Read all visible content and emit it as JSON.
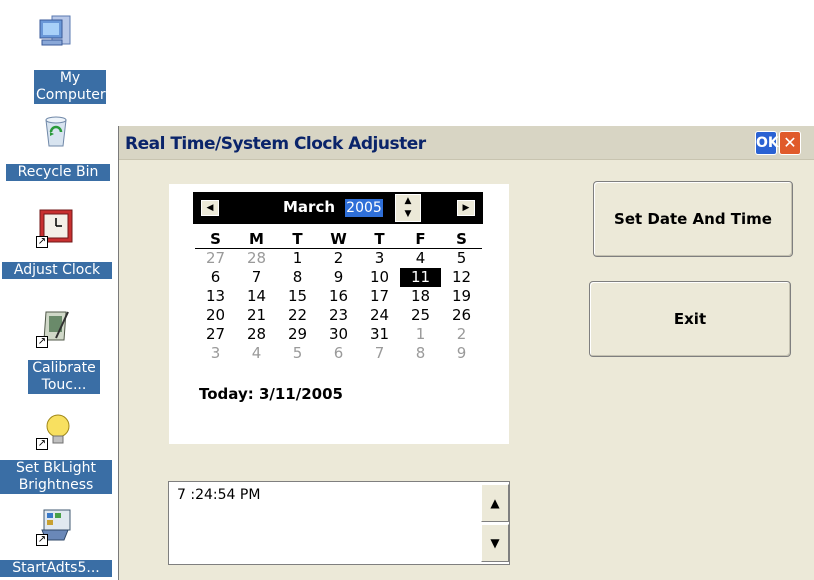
{
  "desktop": {
    "icons": [
      {
        "label1": "My",
        "label2": "Computer",
        "icon": "computer-icon"
      },
      {
        "label1": "Recycle Bin",
        "icon": "recycle-bin-icon"
      },
      {
        "label1": "Adjust Clock",
        "icon": "clock-icon"
      },
      {
        "label1": "Calibrate",
        "label2": "Touc...",
        "icon": "stylus-icon"
      },
      {
        "label1": "Set BkLight",
        "label2": "Brightness",
        "icon": "lightbulb-icon"
      },
      {
        "label1": "StartAdts5...",
        "icon": "program-icon"
      }
    ]
  },
  "window": {
    "title": "Real Time/System Clock Adjuster",
    "ok_label": "OK",
    "close_label": "✕"
  },
  "calendar": {
    "month": "March",
    "year": "2005",
    "weekdays": [
      "S",
      "M",
      "T",
      "W",
      "T",
      "F",
      "S"
    ],
    "weeks": [
      [
        "27",
        "28",
        "1",
        "2",
        "3",
        "4",
        "5"
      ],
      [
        "6",
        "7",
        "8",
        "9",
        "10",
        "11",
        "12"
      ],
      [
        "13",
        "14",
        "15",
        "16",
        "17",
        "18",
        "19"
      ],
      [
        "20",
        "21",
        "22",
        "23",
        "24",
        "25",
        "26"
      ],
      [
        "27",
        "28",
        "29",
        "30",
        "31",
        "1",
        "2"
      ],
      [
        "3",
        "4",
        "5",
        "6",
        "7",
        "8",
        "9"
      ]
    ],
    "selected_day": "11",
    "today_label": "Today: 3/11/2005"
  },
  "time": {
    "value": "7 :24:54 PM"
  },
  "buttons": {
    "set_label": "Set Date And Time",
    "exit_label": "Exit"
  },
  "colors": {
    "desktop_label_bg": "#3a6ea5",
    "title_text": "#0a246a",
    "selection": "#2f6fd8",
    "window_bg": "#ece9d8"
  }
}
